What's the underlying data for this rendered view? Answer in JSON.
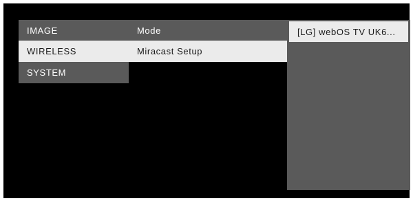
{
  "menu": {
    "categories": [
      {
        "label": "IMAGE",
        "selected": false
      },
      {
        "label": "WIRELESS",
        "selected": true
      },
      {
        "label": "SYSTEM",
        "selected": false
      }
    ]
  },
  "submenu": {
    "items": [
      {
        "label": "Mode",
        "selected": false
      },
      {
        "label": "Miracast Setup",
        "selected": true
      }
    ]
  },
  "device_list": {
    "items": [
      {
        "label": "[LG] webOS TV UK6...",
        "selected": true
      }
    ]
  },
  "colors": {
    "screen_bg": "#000000",
    "panel_bg": "#5a5a5a",
    "highlight_bg": "#ebebeb",
    "text_light": "#ffffff",
    "text_dark": "#1a1a1a"
  }
}
